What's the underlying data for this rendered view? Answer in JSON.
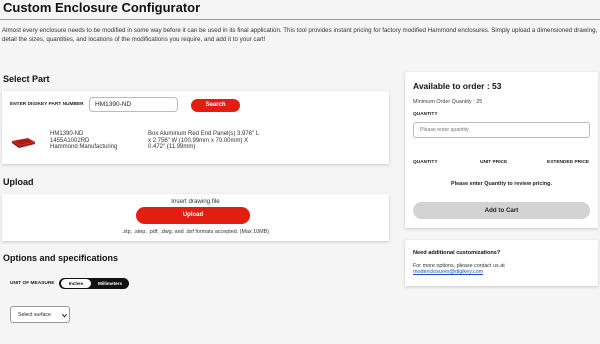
{
  "page": {
    "title": "Custom Enclosure Configurator",
    "intro": "Almost every enclosure needs to be modified in some way before it can be used in its final application. This tool provides instant pricing for factory modified Hammond enclosures. Simply upload a dimensioned drawing, detail the sizes, quantities, and locations of the modifications you require, and add it to your cart!"
  },
  "select_part": {
    "heading": "Select Part",
    "pn_label": "ENTER DIGIKEY PART NUMBER",
    "pn_value": "HM1390-ND",
    "search_label": "Search",
    "thumbnail_icon": "enclosure-thumbnail",
    "product": {
      "digikey_pn": "HM1390-ND",
      "mfr_pn": "1455A1002RD",
      "manufacturer": "Hammond Manufacturing",
      "description_lines": [
        "Box Aluminum Red End Panel(s) 3.976\" L",
        "x 2.756\" W (100.99mm x 70.00mm) X",
        "0.472\" (11.99mm)"
      ]
    }
  },
  "upload": {
    "heading": "Upload",
    "insert_label": "Insert drawing file",
    "button_label": "Upload",
    "formats_note": ".stp, .step, .pdf, .dwg, and .dxf formats accepted. (Max 10MB)"
  },
  "options": {
    "heading": "Options and specifications",
    "uom_label": "UNIT OF MEASURE",
    "uom_options": [
      "Inches",
      "Millimeters"
    ],
    "uom_selected": "Inches",
    "surface_select": "Select surface",
    "surface_icon": "chevron-down-icon"
  },
  "order": {
    "available": "Available to order : 53",
    "min_qty": "Minimum Order Quantity : 25",
    "qty_label": "QUANTITY",
    "qty_placeholder": "Please enter quantity",
    "columns": [
      "QUANTITY",
      "UNIT PRICE",
      "EXTENDED PRICE"
    ],
    "price_message": "Please enter Quantity to review pricing.",
    "add_to_cart": "Add to Cart"
  },
  "customize": {
    "heading": "Need additional customizations?",
    "contact_text": "For more options, please contact us at",
    "email": "modenclosures@digikey.com"
  },
  "colors": {
    "accent_red": "#e31e10",
    "background": "#f5f5f5",
    "link": "#1a4fbf"
  }
}
